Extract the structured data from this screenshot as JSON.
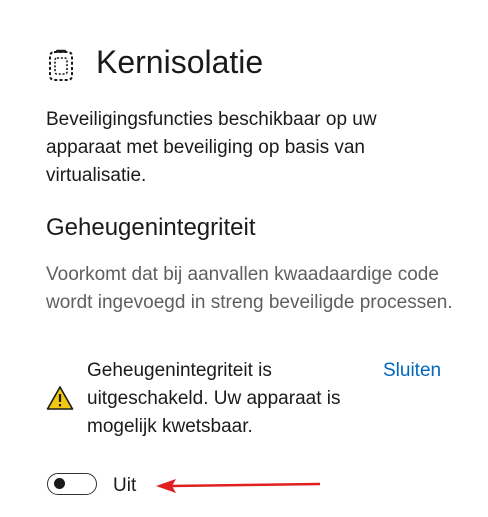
{
  "header": {
    "icon": "core-isolation-icon",
    "title": "Kernisolatie"
  },
  "description": "Beveiligingsfuncties beschikbaar op uw apparaat met beveiliging op basis van virtualisatie.",
  "memory_integrity": {
    "title": "Geheugenintegriteit",
    "description": "Voorkomt dat bij aanvallen kwaadaardige code wordt ingevoegd in streng beveiligde processen.",
    "warning": {
      "icon": "warning-icon",
      "text": "Geheugenintegriteit is uitgeschakeld. Uw apparaat is mogelijk kwetsbaar.",
      "dismiss_label": "Sluiten"
    },
    "toggle": {
      "state": "off",
      "label": "Uit"
    }
  },
  "annotation": {
    "arrow_color": "#e02020"
  },
  "colors": {
    "link": "#0067c0",
    "warning_fill": "#f2c811"
  }
}
